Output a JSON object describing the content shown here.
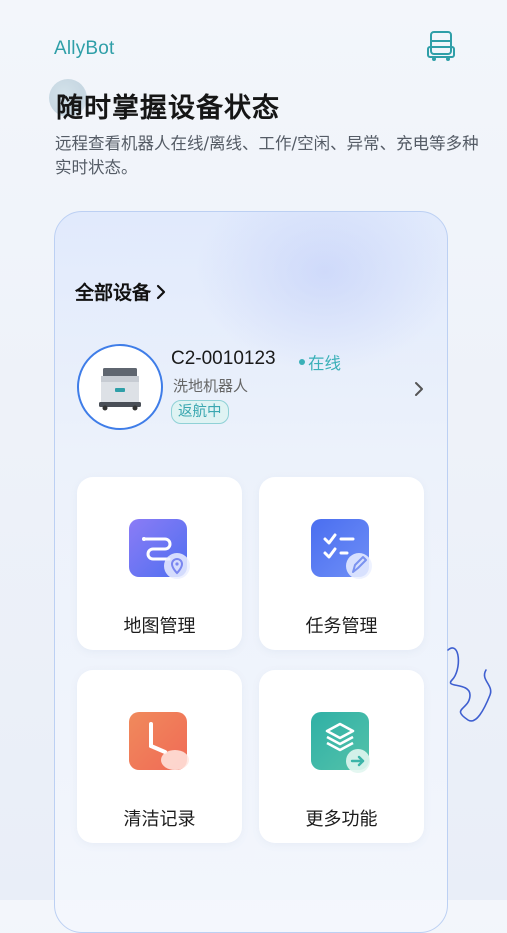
{
  "app": {
    "brand": "AllyBot"
  },
  "intro": {
    "headline": "随时掌握设备状态",
    "subtext": "远程查看机器人在线/离线、工作/空闲、异常、充电等多种实时状态。"
  },
  "devices": {
    "all_label": "全部设备",
    "current": {
      "id": "C2-0010123",
      "online_label": "在线",
      "type": "洗地机器人",
      "status": "返航中"
    }
  },
  "tiles": [
    {
      "label": "地图管理",
      "icon": "map-icon"
    },
    {
      "label": "任务管理",
      "icon": "task-icon"
    },
    {
      "label": "清洁记录",
      "icon": "clock-icon"
    },
    {
      "label": "更多功能",
      "icon": "layers-icon"
    }
  ],
  "colors": {
    "brand": "#2f9fa8",
    "online": "#3ab0b8",
    "accent_blue": "#3f7de8",
    "map_tile": "#6b78f0",
    "task_tile": "#4f7cf0",
    "record_tile": "#f07a58",
    "more_tile": "#3bb4a8"
  }
}
